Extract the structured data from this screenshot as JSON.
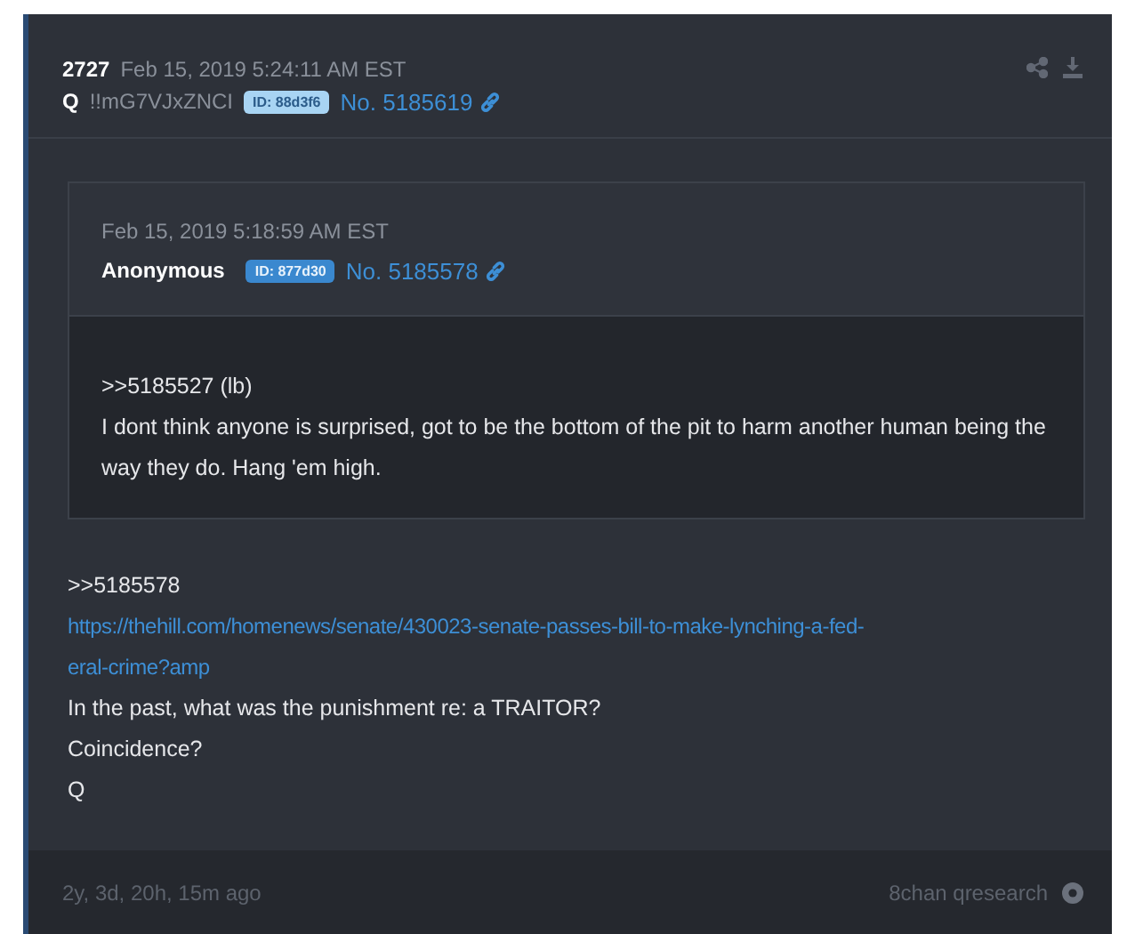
{
  "post": {
    "number": "2727",
    "date": "Feb 15, 2019 5:24:11 AM EST",
    "name": "Q",
    "tripcode": "!!mG7VJxZNCI",
    "id_badge": "ID: 88d3f6",
    "post_no": "No. 5185619",
    "quoted": {
      "date": "Feb 15, 2019 5:18:59 AM EST",
      "name": "Anonymous",
      "id_badge": "ID: 877d30",
      "post_no": "No. 5185578",
      "lines": [
        ">>5185527 (lb)",
        "I dont think anyone is surprised, got to be the bottom of the pit to harm another human being the way they do. Hang 'em high."
      ]
    },
    "body": [
      {
        "kind": "text",
        "text": ">>5185578"
      },
      {
        "kind": "link",
        "lines": [
          "https://thehill.com/homenews/senate/430023-senate-passes-bill-to-make-lynching-a-fed-",
          "eral-crime?amp"
        ]
      },
      {
        "kind": "text",
        "text": "In the past, what was the punishment re: a TRAITOR?"
      },
      {
        "kind": "text",
        "text": "Coincidence?"
      },
      {
        "kind": "text",
        "text": "Q"
      }
    ],
    "footer": {
      "age": "2y, 3d, 20h, 15m ago",
      "source": "8chan qresearch"
    }
  }
}
